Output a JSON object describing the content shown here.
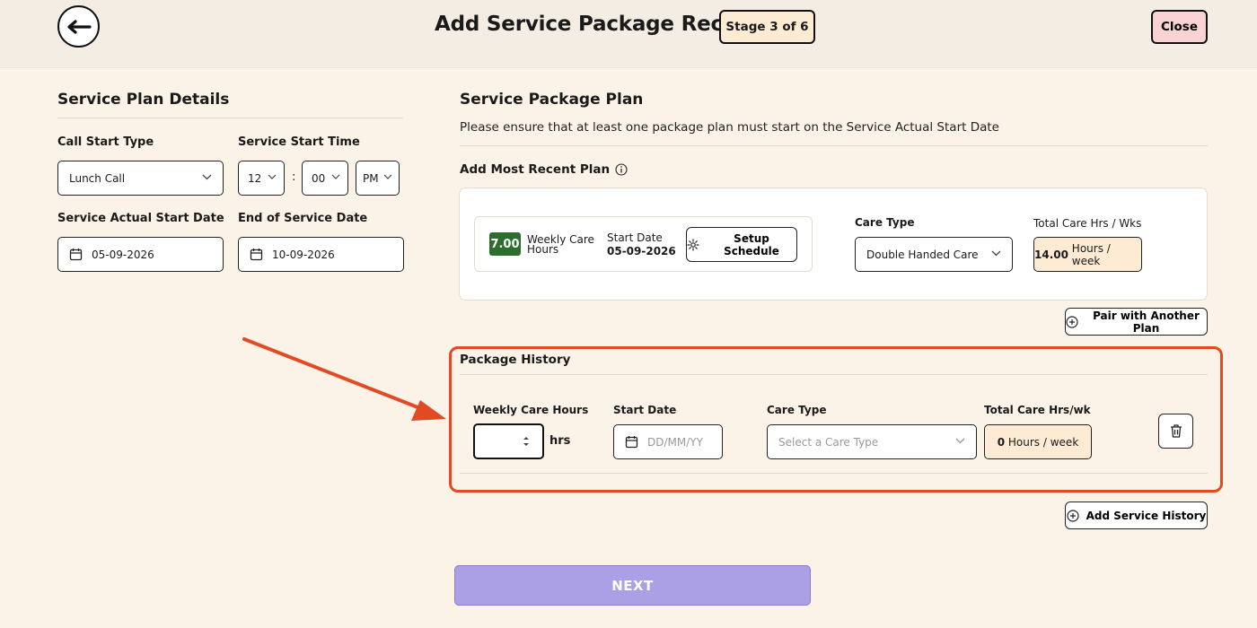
{
  "header": {
    "title": "Add Service Package Record",
    "stage": "Stage 3 of 6",
    "close_label": "Close"
  },
  "plan_details": {
    "title": "Service Plan Details",
    "call_start_type_label": "Call Start Type",
    "call_start_type_value": "Lunch Call",
    "service_start_time_label": "Service Start Time",
    "hour": "12",
    "minute": "00",
    "meridiem": "PM",
    "time_separator": ":",
    "actual_start_label": "Service Actual Start Date",
    "actual_start_value": "05-09-2026",
    "end_label": "End of Service Date",
    "end_value": "10-09-2026"
  },
  "package_plan": {
    "title": "Service Package Plan",
    "helper": "Please ensure that at least one package plan must start on the Service Actual Start Date",
    "recent_label": "Add Most Recent Plan",
    "hours_value": "7.00",
    "hours_label_line1": "Weekly Care",
    "hours_label_line2": "Hours",
    "start_date_label": "Start Date",
    "start_date_value": "05-09-2026",
    "setup_schedule_label": "Setup Schedule",
    "care_type_label": "Care Type",
    "care_type_value": "Double Handed Care",
    "total_label": "Total Care Hrs / Wks",
    "total_value": "14.00",
    "total_unit": "Hours / week",
    "pair_label": "Pair with Another Plan"
  },
  "history": {
    "title": "Package History",
    "weekly_hours_label": "Weekly Care Hours",
    "weekly_hours_value": "",
    "hrs_suffix": "hrs",
    "start_date_label": "Start Date",
    "start_date_placeholder": "DD/MM/YY",
    "care_type_label": "Care Type",
    "care_type_placeholder": "Select a Care Type",
    "total_label": "Total Care Hrs/wk",
    "total_value": "0",
    "total_unit": "Hours / week",
    "add_label": "Add Service History"
  },
  "footer": {
    "next_label": "NEXT"
  },
  "colors": {
    "background": "#fcf3e8",
    "accent_next": "#ab9fe6",
    "highlight": "#e24a24",
    "hours_badge": "#2d6e2f",
    "close_button": "#f9d3d3"
  },
  "icons": [
    "arrow-left-icon",
    "chevron-down-icon",
    "calendar-icon",
    "info-icon",
    "gear-icon",
    "plus-circle-icon",
    "trash-icon",
    "spinner-icon"
  ]
}
